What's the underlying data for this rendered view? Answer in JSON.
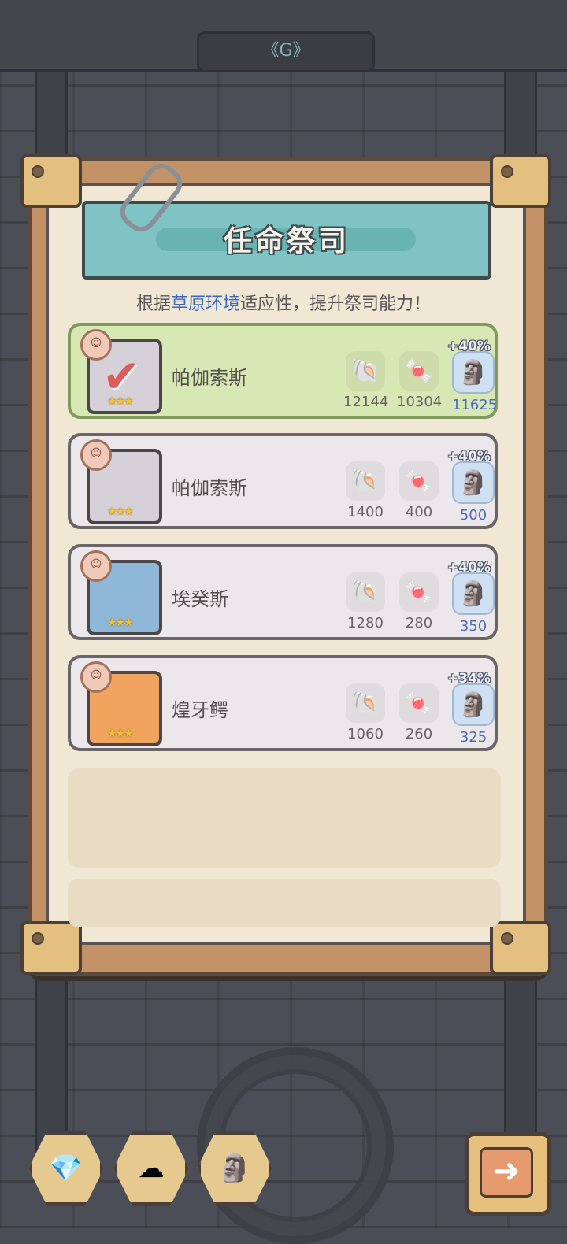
{
  "header": {
    "top_symbol": "《G》"
  },
  "panel": {
    "title": "任命祭司",
    "subtitle_prefix": "根据",
    "subtitle_highlight": "草原环境",
    "subtitle_suffix": "适应性，提升祭司能力！"
  },
  "priests": [
    {
      "name": "帕伽索斯",
      "selected": true,
      "stat1": "12144",
      "stat2": "10304",
      "stat3": "11625",
      "bonus": "+40%"
    },
    {
      "name": "帕伽索斯",
      "selected": false,
      "stat1": "1400",
      "stat2": "400",
      "stat3": "500",
      "bonus": "+40%"
    },
    {
      "name": "埃癸斯",
      "selected": false,
      "stat1": "1280",
      "stat2": "280",
      "stat3": "350",
      "bonus": "+40%"
    },
    {
      "name": "煌牙鳄",
      "selected": false,
      "stat1": "1060",
      "stat2": "260",
      "stat3": "325",
      "bonus": "+34%"
    }
  ],
  "icons": {
    "stat1": "shell-icon",
    "stat2": "candy-icon",
    "stat3": "idol-icon",
    "bottom": [
      "crystal-icon",
      "cloud-icon",
      "totem-icon"
    ],
    "next": "arrow-right-icon"
  },
  "colors": {
    "highlight": "#3c66c4",
    "selected_row": "#d8e8b4",
    "bonus_value": "#4a6bbd"
  }
}
